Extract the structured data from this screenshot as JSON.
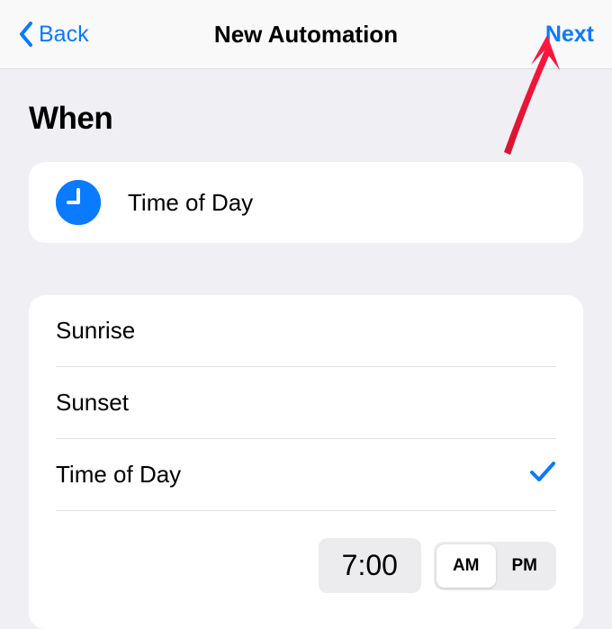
{
  "nav": {
    "back_label": "Back",
    "title": "New Automation",
    "next_label": "Next"
  },
  "section": {
    "header": "When",
    "summary_label": "Time of Day"
  },
  "options": {
    "sunrise": "Sunrise",
    "sunset": "Sunset",
    "time_of_day": "Time of Day",
    "selected": "time_of_day"
  },
  "time": {
    "value": "7:00",
    "am_label": "AM",
    "pm_label": "PM",
    "period": "AM"
  }
}
